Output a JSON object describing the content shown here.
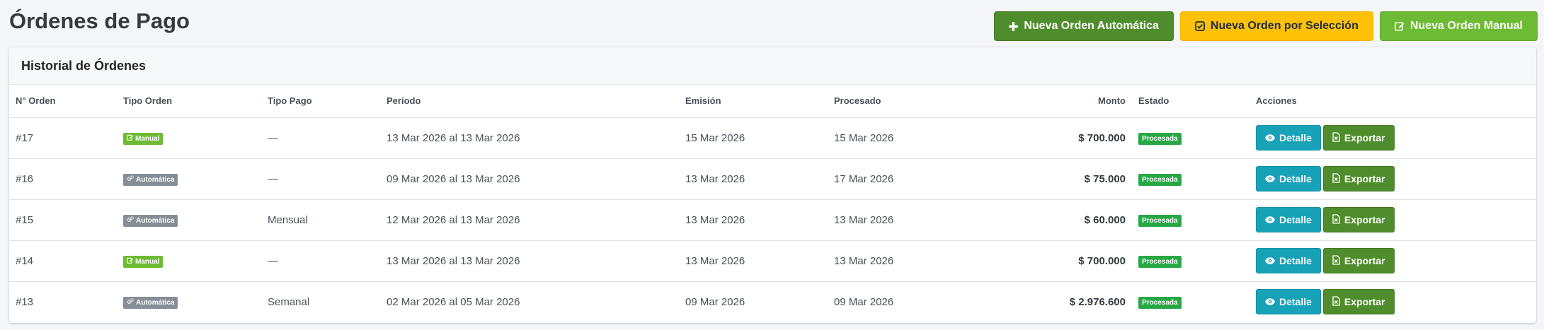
{
  "page": {
    "title": "Órdenes de Pago"
  },
  "actions": {
    "auto_label": "Nueva Orden Automática",
    "seleccion_label": "Nueva Orden por Selección",
    "manual_label": "Nueva Orden Manual"
  },
  "card": {
    "title": "Historial de Órdenes"
  },
  "table": {
    "headers": {
      "numero": "N° Orden",
      "tipo_orden": "Tipo Orden",
      "tipo_pago": "Tipo Pago",
      "periodo": "Período",
      "emision": "Emisión",
      "procesado": "Procesado",
      "monto": "Monto",
      "estado": "Estado",
      "acciones": "Acciones"
    },
    "rows": [
      {
        "numero": "#17",
        "tipo_orden": "Manual",
        "tipo_pago": "—",
        "periodo": "13 Mar 2026 al 13 Mar 2026",
        "emision": "15 Mar 2026",
        "procesado": "15 Mar 2026",
        "monto": "$ 700.000",
        "estado": "Procesada",
        "detalle": "Detalle",
        "exportar": "Exportar"
      },
      {
        "numero": "#16",
        "tipo_orden": "Automática",
        "tipo_pago": "—",
        "periodo": "09 Mar 2026 al 13 Mar 2026",
        "emision": "13 Mar 2026",
        "procesado": "17 Mar 2026",
        "monto": "$ 75.000",
        "estado": "Procesada",
        "detalle": "Detalle",
        "exportar": "Exportar"
      },
      {
        "numero": "#15",
        "tipo_orden": "Automática",
        "tipo_pago": "Mensual",
        "periodo": "12 Mar 2026 al 13 Mar 2026",
        "emision": "13 Mar 2026",
        "procesado": "13 Mar 2026",
        "monto": "$ 60.000",
        "estado": "Procesada",
        "detalle": "Detalle",
        "exportar": "Exportar"
      },
      {
        "numero": "#14",
        "tipo_orden": "Manual",
        "tipo_pago": "—",
        "periodo": "13 Mar 2026 al 13 Mar 2026",
        "emision": "13 Mar 2026",
        "procesado": "13 Mar 2026",
        "monto": "$ 700.000",
        "estado": "Procesada",
        "detalle": "Detalle",
        "exportar": "Exportar"
      },
      {
        "numero": "#13",
        "tipo_orden": "Automática",
        "tipo_pago": "Semanal",
        "periodo": "02 Mar 2026 al 05 Mar 2026",
        "emision": "09 Mar 2026",
        "procesado": "09 Mar 2026",
        "monto": "$ 2.976.600",
        "estado": "Procesada",
        "detalle": "Detalle",
        "exportar": "Exportar"
      }
    ]
  },
  "colors": {
    "primary_green_dark": "#4f8d2c",
    "warning_yellow": "#ffc107",
    "success_green": "#6dba34",
    "info_teal": "#17a2b8",
    "status_green": "#28a745",
    "auto_gray": "#858d96"
  },
  "icons": {
    "auto_button": "plus-icon",
    "seleccion_button": "check-square-icon",
    "manual_button": "edit-icon",
    "badge_manual": "edit-icon",
    "badge_auto": "cogs-icon",
    "detalle": "eye-icon",
    "exportar": "file-excel-icon"
  }
}
